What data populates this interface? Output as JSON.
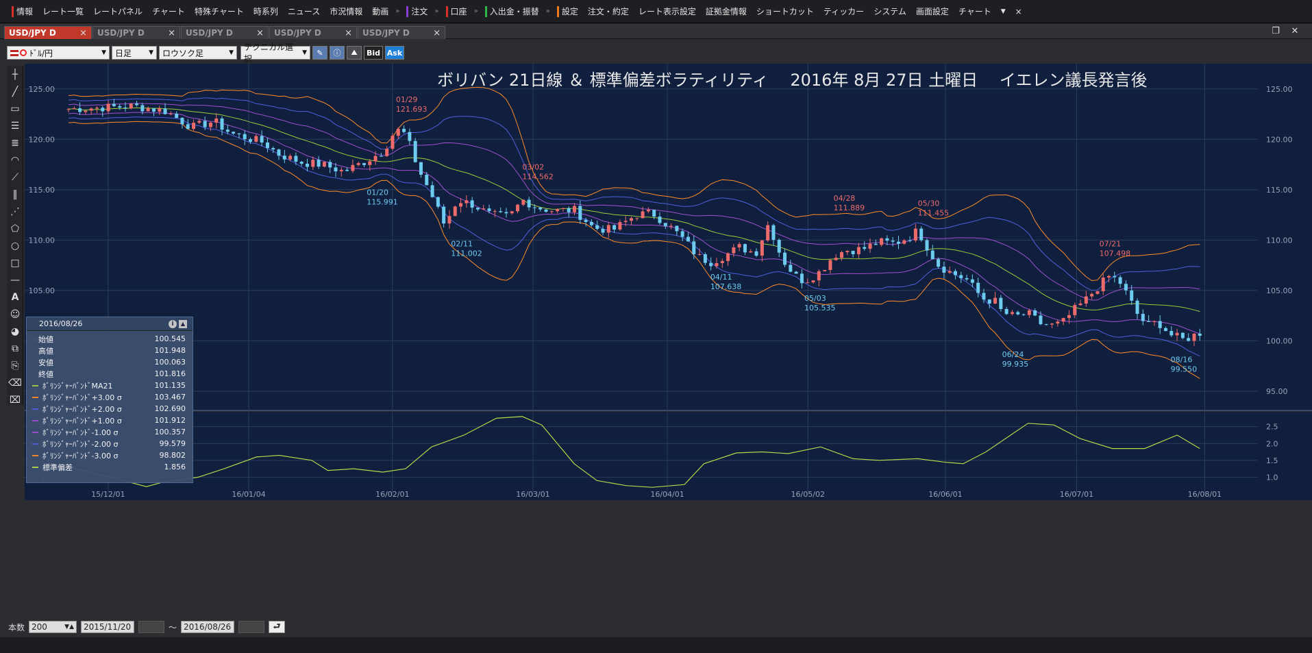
{
  "menu": {
    "items": [
      {
        "label": "情報",
        "bar": "#d9302b"
      },
      {
        "label": "レート一覧"
      },
      {
        "label": "レートパネル"
      },
      {
        "label": "チャート"
      },
      {
        "label": "特殊チャート"
      },
      {
        "label": "時系列"
      },
      {
        "label": "ニュース"
      },
      {
        "label": "市況情報"
      },
      {
        "label": "動画"
      },
      {
        "label": "注文",
        "bar": "#8b3fd6"
      },
      {
        "label": "口座",
        "bar": "#d9302b"
      },
      {
        "label": "入出金・振替",
        "bar": "#2fb84a"
      },
      {
        "label": "設定",
        "bar": "#ee7b1e"
      },
      {
        "label": "注文・約定"
      },
      {
        "label": "レート表示設定"
      },
      {
        "label": "証拠金情報"
      },
      {
        "label": "ショートカット"
      },
      {
        "label": "ティッカー"
      },
      {
        "label": "システム"
      },
      {
        "label": "画面設定"
      },
      {
        "label": "チャート"
      }
    ],
    "overflow": "»",
    "dropdown": "▼",
    "close": "×"
  },
  "tabs": [
    {
      "label": "USD/JPY D",
      "active": true
    },
    {
      "label": "USD/JPY D",
      "active": false
    },
    {
      "label": "USD/JPY D",
      "active": false
    },
    {
      "label": "USD/JPY D",
      "active": false
    },
    {
      "label": "USD/JPY D",
      "active": false
    }
  ],
  "tab_close": "×",
  "window": {
    "restore": "❐",
    "close": "✕"
  },
  "toolbar": {
    "pair": "ﾄﾞﾙ/円",
    "timeframe": "日足",
    "chart_type": "ロウソク足",
    "technical": "テクニカル選択",
    "bid": "Bid",
    "ask": "Ask"
  },
  "chart_title": "ボリバン 21日線 ＆ 標準偏差ボラティリティ　 2016年 8月 27日 土曜日　 イエレン議長発言後",
  "colors": {
    "bg": "#0f1f3d",
    "grid": "#2c3d5c",
    "up": "#ee6b6b",
    "down": "#6ecbf0",
    "ma": "#9ccc3c",
    "s1": "#a050d0",
    "s2": "#5060e0",
    "s3": "#ff8c2a",
    "vol": "#b4d84a"
  },
  "chart_data": {
    "type": "candlestick",
    "price_axis": {
      "ticks": [
        "125.00",
        "120.00",
        "115.00",
        "110.00",
        "105.00",
        "100.00",
        "95.00"
      ],
      "ylim": [
        93.5,
        127.5
      ]
    },
    "date_axis": [
      "15/12/01",
      "16/01/04",
      "16/02/01",
      "16/03/01",
      "16/04/01",
      "16/05/02",
      "16/06/01",
      "16/07/01",
      "16/08/01"
    ],
    "close_path": [
      [
        0,
        123.0
      ],
      [
        20,
        123.3
      ],
      [
        30,
        122.8
      ],
      [
        38,
        121.2
      ],
      [
        45,
        121.8
      ],
      [
        50,
        120.6
      ],
      [
        60,
        119.7
      ],
      [
        65,
        118.5
      ],
      [
        72,
        117.7
      ],
      [
        78,
        117.5
      ],
      [
        85,
        116.8
      ],
      [
        92,
        117.9
      ],
      [
        97,
        118.8
      ],
      [
        101,
        121.0
      ],
      [
        104,
        120.5
      ],
      [
        108,
        117.0
      ],
      [
        112,
        114.5
      ],
      [
        116,
        111.5
      ],
      [
        120,
        114.0
      ],
      [
        125,
        113.5
      ],
      [
        130,
        112.5
      ],
      [
        136,
        112.3
      ],
      [
        140,
        114.0
      ],
      [
        145,
        113.2
      ],
      [
        150,
        112.9
      ],
      [
        156,
        113.0
      ],
      [
        162,
        111.2
      ],
      [
        168,
        111.0
      ],
      [
        175,
        112.5
      ],
      [
        180,
        112.7
      ],
      [
        185,
        111.5
      ],
      [
        190,
        110.0
      ],
      [
        194,
        108.4
      ],
      [
        198,
        107.8
      ],
      [
        202,
        108.4
      ],
      [
        207,
        109.3
      ],
      [
        212,
        108.7
      ],
      [
        216,
        111.7
      ],
      [
        220,
        108.2
      ],
      [
        224,
        106.5
      ],
      [
        227,
        105.9
      ],
      [
        232,
        106.9
      ],
      [
        236,
        108.5
      ],
      [
        240,
        109.0
      ],
      [
        245,
        109.1
      ],
      [
        250,
        109.8
      ],
      [
        255,
        109.7
      ],
      [
        260,
        110.4
      ],
      [
        262,
        111.0
      ],
      [
        264,
        109.8
      ],
      [
        268,
        107.6
      ],
      [
        272,
        106.8
      ],
      [
        277,
        106.1
      ],
      [
        282,
        104.2
      ],
      [
        286,
        103.9
      ],
      [
        288,
        102.8
      ],
      [
        292,
        102.4
      ],
      [
        296,
        102.7
      ],
      [
        300,
        101.7
      ],
      [
        304,
        101.5
      ],
      [
        307,
        101.9
      ],
      [
        310,
        103.0
      ],
      [
        313,
        103.8
      ],
      [
        318,
        105.5
      ],
      [
        321,
        106.4
      ],
      [
        324,
        106.0
      ],
      [
        326,
        104.9
      ],
      [
        330,
        102.5
      ],
      [
        333,
        101.5
      ],
      [
        336,
        101.9
      ],
      [
        340,
        100.6
      ],
      [
        344,
        100.1
      ],
      [
        349,
        100.8
      ]
    ],
    "highs": [
      {
        "date": "01/29",
        "value": "121.693"
      },
      {
        "date": "03/02",
        "value": "114.562"
      },
      {
        "date": "04/28",
        "value": "111.889"
      },
      {
        "date": "05/30",
        "value": "111.455"
      },
      {
        "date": "07/21",
        "value": "107.498"
      }
    ],
    "lows": [
      {
        "date": "01/20",
        "value": "115.991"
      },
      {
        "date": "02/11",
        "value": "111.002"
      },
      {
        "date": "04/11",
        "value": "107.638"
      },
      {
        "date": "05/03",
        "value": "105.535"
      },
      {
        "date": "06/24",
        "value": "99.935"
      },
      {
        "date": "08/16",
        "value": "99.550"
      }
    ],
    "sub_chart": {
      "title": "標準偏差",
      "ticks": [
        "2.5",
        "2.0",
        "1.5",
        "1.0"
      ],
      "ylim": [
        0.5,
        2.9
      ],
      "values": [
        [
          0,
          1.3
        ],
        [
          15,
          0.95
        ],
        [
          24,
          0.72
        ],
        [
          29,
          0.85
        ],
        [
          40,
          1.0
        ],
        [
          48,
          1.25
        ],
        [
          58,
          1.6
        ],
        [
          65,
          1.65
        ],
        [
          75,
          1.5
        ],
        [
          80,
          1.2
        ],
        [
          88,
          1.25
        ],
        [
          97,
          1.15
        ],
        [
          104,
          1.25
        ],
        [
          112,
          1.9
        ],
        [
          122,
          2.25
        ],
        [
          132,
          2.75
        ],
        [
          140,
          2.8
        ],
        [
          146,
          2.55
        ],
        [
          156,
          1.4
        ],
        [
          163,
          0.9
        ],
        [
          172,
          0.75
        ],
        [
          180,
          0.7
        ],
        [
          190,
          0.78
        ],
        [
          196,
          1.4
        ],
        [
          206,
          1.72
        ],
        [
          214,
          1.75
        ],
        [
          222,
          1.7
        ],
        [
          232,
          1.9
        ],
        [
          242,
          1.55
        ],
        [
          250,
          1.5
        ],
        [
          262,
          1.55
        ],
        [
          270,
          1.45
        ],
        [
          276,
          1.4
        ],
        [
          283,
          1.75
        ],
        [
          296,
          2.6
        ],
        [
          304,
          2.55
        ],
        [
          312,
          2.15
        ],
        [
          322,
          1.85
        ],
        [
          332,
          1.85
        ],
        [
          342,
          2.25
        ],
        [
          349,
          1.85
        ]
      ]
    }
  },
  "data_panel": {
    "date": "2016/08/26",
    "rows": [
      {
        "label": "始値",
        "value": "100.545"
      },
      {
        "label": "高値",
        "value": "101.948"
      },
      {
        "label": "安値",
        "value": "100.063"
      },
      {
        "label": "終値",
        "value": "101.816"
      },
      {
        "label": "ﾎﾞﾘﾝｼﾞｬｰﾊﾞﾝﾄﾞMA21",
        "value": "101.135",
        "color": "#9ccc3c"
      },
      {
        "label": "ﾎﾞﾘﾝｼﾞｬｰﾊﾞﾝﾄﾞ+3.00 σ",
        "value": "103.467",
        "color": "#ff8c2a"
      },
      {
        "label": "ﾎﾞﾘﾝｼﾞｬｰﾊﾞﾝﾄﾞ+2.00 σ",
        "value": "102.690",
        "color": "#5060e0"
      },
      {
        "label": "ﾎﾞﾘﾝｼﾞｬｰﾊﾞﾝﾄﾞ+1.00 σ",
        "value": "101.912",
        "color": "#a050d0"
      },
      {
        "label": "ﾎﾞﾘﾝｼﾞｬｰﾊﾞﾝﾄﾞ-1.00 σ",
        "value": "100.357",
        "color": "#a050d0"
      },
      {
        "label": "ﾎﾞﾘﾝｼﾞｬｰﾊﾞﾝﾄﾞ-2.00 σ",
        "value": "99.579",
        "color": "#5060e0"
      },
      {
        "label": "ﾎﾞﾘﾝｼﾞｬｰﾊﾞﾝﾄﾞ-3.00 σ",
        "value": "98.802",
        "color": "#ff8c2a"
      },
      {
        "label": "標準偏差",
        "value": "1.856",
        "color": "#b4d84a"
      }
    ]
  },
  "bottom": {
    "count_label": "本数",
    "count": "200",
    "start_date": "2015/11/20",
    "tilde": "～",
    "end_date": "2016/08/26",
    "apply": "⮐"
  }
}
